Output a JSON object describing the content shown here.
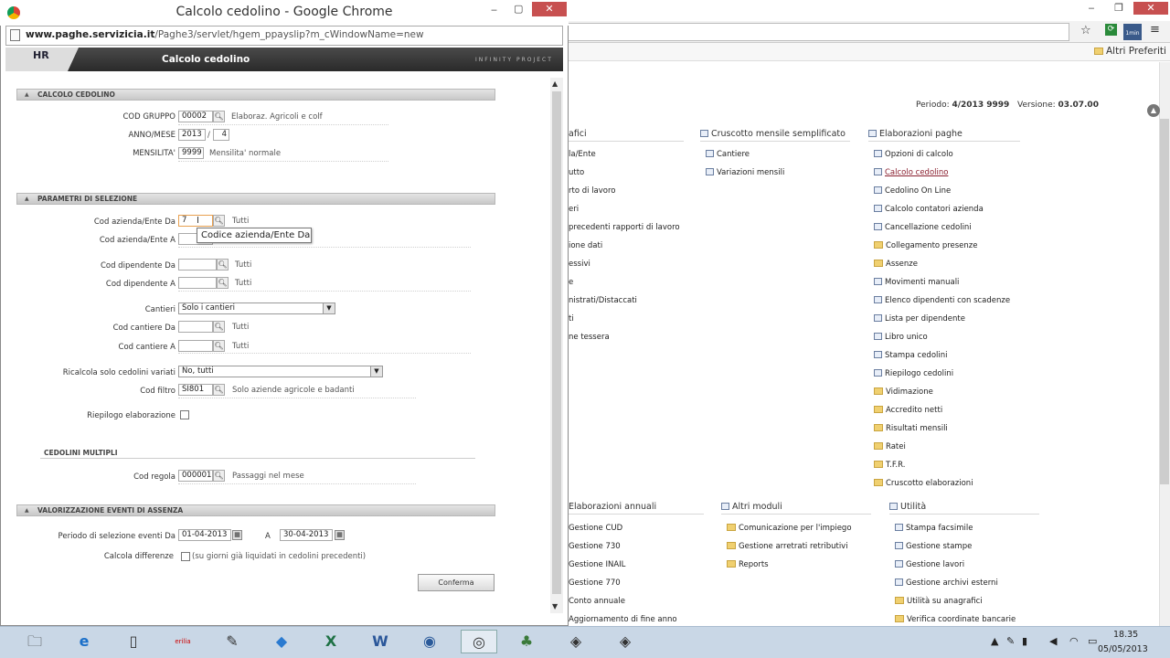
{
  "popup": {
    "title": "Calcolo cedolino - Google Chrome",
    "url": "www.paghe.servizicia.it/Paghe3/servlet/hgem_ppayslip?m_cWindowName=new",
    "app_title": "Calcolo cedolino",
    "app_brand": "INFINITY PROJECT",
    "logo_text": "HR"
  },
  "form": {
    "section_calcolo": "CALCOLO CEDOLINO",
    "cod_gruppo_label": "COD GRUPPO",
    "cod_gruppo_value": "00002",
    "cod_gruppo_desc": "Elaboraz. Agricoli e colf",
    "anno_mese_label": "ANNO/MESE",
    "anno_value": "2013",
    "mese_sep": "/",
    "mese_value": "4",
    "mensilita_label": "MENSILITA'",
    "mensilita_value": "9999",
    "mensilita_desc": "Mensilita' normale",
    "section_parametri": "PARAMETRI DI SELEZIONE",
    "az_da_label": "Cod azienda/Ente Da",
    "az_da_value": "7",
    "az_da_desc": "Tutti",
    "az_a_label": "Cod azienda/Ente A",
    "tooltip": "Codice azienda/Ente Da",
    "dip_da_label": "Cod dipendente Da",
    "dip_da_desc": "Tutti",
    "dip_a_label": "Cod dipendente A",
    "dip_a_desc": "Tutti",
    "cantieri_label": "Cantieri",
    "cantieri_value": "Solo i cantieri",
    "cant_da_label": "Cod cantiere Da",
    "cant_da_desc": "Tutti",
    "cant_a_label": "Cod cantiere A",
    "cant_a_desc": "Tutti",
    "ricalcola_label": "Ricalcola solo cedolini variati",
    "ricalcola_value": "No, tutti",
    "filtro_label": "Cod filtro",
    "filtro_value": "SI801",
    "filtro_desc": "Solo aziende agricole e badanti",
    "riepilogo_label": "Riepilogo elaborazione",
    "section_multipli": "CEDOLINI MULTIPLI",
    "regola_label": "Cod regola",
    "regola_value": "000001",
    "regola_desc": "Passaggi nel mese",
    "section_assenza": "VALORIZZAZIONE EVENTI DI ASSENZA",
    "periodo_label": "Periodo di selezione eventi Da",
    "periodo_da": "01-04-2013",
    "periodo_a_label": "A",
    "periodo_a": "30-04-2013",
    "calcola_label": "Calcola differenze",
    "calcola_desc": "(su giorni già liquidati in cedolini precedenti)",
    "confirm_button": "Conferma"
  },
  "background": {
    "bookmarks": "Altri Preferiti",
    "periodo_label": "Periodo:",
    "periodo_value": "4/2013 9999",
    "versione_label": "Versione:",
    "versione_value": "03.07.00",
    "col1_title": "afici",
    "col1_items": [
      "la/Ente",
      "utto",
      "rto di lavoro",
      "eri",
      "precedenti rapporti di lavoro",
      "ione dati",
      "essivi",
      "e",
      "nistrati/Distaccati",
      "ti",
      "ne tessera"
    ],
    "col2_title": "Cruscotto mensile semplificato",
    "col2_items": [
      "Cantiere",
      "Variazioni mensili"
    ],
    "col3_title": "Elaborazioni paghe",
    "col3_items": [
      "Opzioni di calcolo",
      "Calcolo cedolino",
      "Cedolino On Line",
      "Calcolo contatori azienda",
      "Cancellazione cedolini",
      "Collegamento presenze",
      "Assenze",
      "Movimenti manuali",
      "Elenco dipendenti con scadenze",
      "Lista per dipendente",
      "Libro unico",
      "Stampa cedolini",
      "Riepilogo cedolini",
      "Vidimazione",
      "Accredito netti",
      "Risultati mensili",
      "Ratei",
      "T.F.R.",
      "Cruscotto elaborazioni"
    ],
    "col4_title": "Elaborazioni annuali",
    "col4_items": [
      "Gestione CUD",
      "Gestione 730",
      "Gestione INAIL",
      "Gestione 770",
      "Conto annuale",
      "Aggiornamento di fine anno"
    ],
    "col5_title": "Altri moduli",
    "col5_items": [
      "Comunicazione per l'impiego",
      "Gestione arretrati retributivi",
      "Reports"
    ],
    "col6_title": "Utilità",
    "col6_items": [
      "Stampa facsimile",
      "Gestione stampe",
      "Gestione lavori",
      "Gestione archivi esterni",
      "Utilità su anagrafici",
      "Verifica coordinate bancarie"
    ],
    "ext_badge": "1min"
  },
  "taskbar": {
    "time": "18.35",
    "date": "05/05/2013"
  }
}
